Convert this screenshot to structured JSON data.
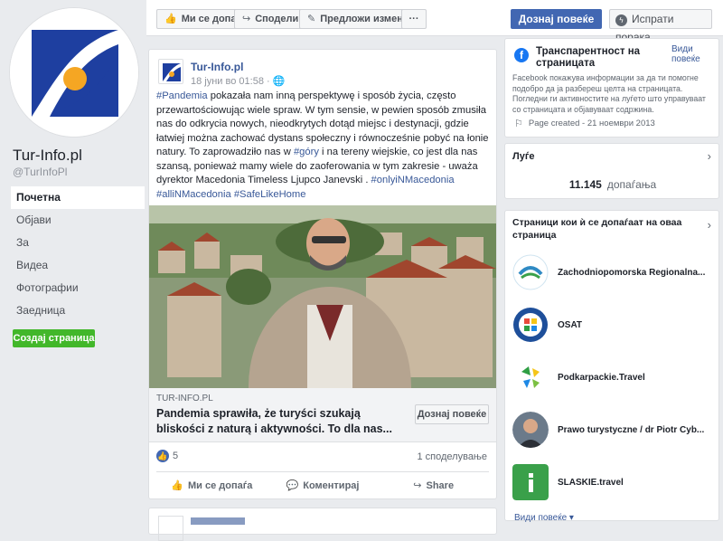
{
  "page": {
    "name": "Tur-Info.pl",
    "handle": "@TurInfoPl"
  },
  "nav": {
    "items": [
      "Почетна",
      "Објави",
      "За",
      "Видеа",
      "Фотографии",
      "Заедница"
    ],
    "create_page": "Создај страница"
  },
  "topbar": {
    "like": "Ми се допаѓа",
    "share": "Сподели",
    "suggest": "Предложи измени",
    "more": "···",
    "learn_more": "Дознај повеќе",
    "send_message": "Испрати порака"
  },
  "post": {
    "author": "Tur-Info.pl",
    "time": "18 јуни во 01:58 ·",
    "text_parts": {
      "t1": "#Pandemia",
      "t2": " pokazała nam inną perspektywę i sposób życia, często przewartościowując wiele spraw. W tym sensie, w pewien sposób zmusiła nas do odkrycia nowych, nieodkrytych dotąd miejsc i destynacji, gdzie łatwiej można zachować dystans społeczny i równocześnie pobyć na łonie natury. To zaprowadziło nas w ",
      "t3": "#góry",
      "t4": " i na tereny wiejskie, co jest dla nas szansą, ponieważ mamy wiele do zaoferowania w tym zakresie - uważa dyrektor Macedonia Timeless Ljupco Janevski . ",
      "t5": "#onlyiNMacedonia",
      "t6": " ",
      "t7": "#alliNMacedonia",
      "t8": " ",
      "t9": "#SafeLikeHome"
    },
    "link_domain": "TUR-INFO.PL",
    "link_title": "Pandemia sprawiła, że turyści szukają bliskości z naturą i aktywności. To dla nas...",
    "learn_more": "Дознај повеќе",
    "reactions_count": "5",
    "shares": "1 споделување",
    "action_like": "Ми се допаѓа",
    "action_comment": "Коментирај",
    "action_share": "Share"
  },
  "transparency": {
    "title": "Транспарентност на страницата",
    "see_more": "Види повеќе",
    "description": "Facebook покажува информации за да ти помогне подобро да ја разбереш целта на страницата. Погледни ги активностите на луѓето што управуваат со страницата и објавуваат содржина.",
    "page_created": "Page created - 21 ноември 2013"
  },
  "likes": {
    "title": "Луѓе",
    "count": "11.145",
    "label": "допаѓања"
  },
  "liked_pages": {
    "title": "Страници кои ѝ се допаѓаат на оваа страница",
    "items": [
      "Zachodniopomorska Regionalna...",
      "OSAT",
      "Podkarpackie.Travel",
      "Prawo turystyczne / dr Piotr Cyb...",
      "SLASKIE.travel"
    ],
    "see_more": "Види повеќе ▾"
  },
  "colors": {
    "facebook_blue": "#4267b2",
    "link_blue": "#385898",
    "green": "#42b72a",
    "background": "#e9ebee"
  }
}
